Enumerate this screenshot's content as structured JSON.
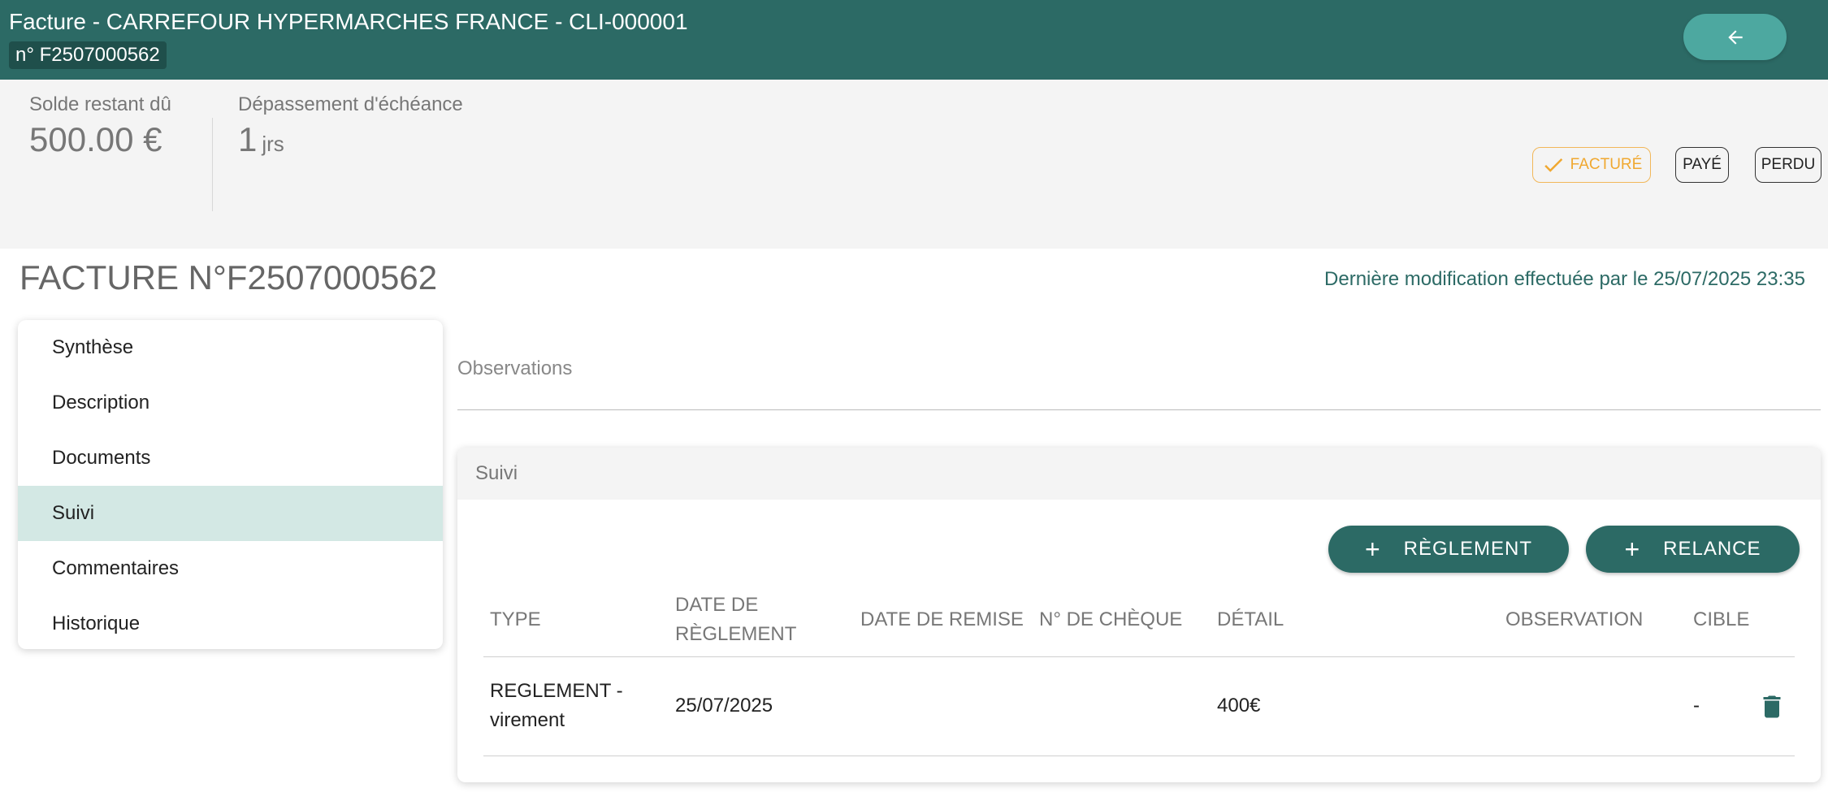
{
  "header": {
    "title": "Facture - CARREFOUR HYPERMARCHES FRANCE - CLI-000001",
    "subtitle": "n° F2507000562",
    "back_icon": "arrow-left-icon"
  },
  "summary": {
    "balance_label": "Solde restant dû",
    "balance_value": "500.00 €",
    "overdue_label": "Dépassement d'échéance",
    "overdue_value": "1",
    "overdue_unit": "jrs"
  },
  "status": {
    "facture_label": "FACTURÉ",
    "paye_label": "PAYÉ",
    "perdu_label": "PERDU",
    "active_color": "#f0a830"
  },
  "document": {
    "title": "FACTURE N°F2507000562",
    "last_modified": "Dernière modification effectuée par le 25/07/2025 23:35"
  },
  "menu": {
    "items": [
      {
        "label": "Synthèse"
      },
      {
        "label": "Description"
      },
      {
        "label": "Documents"
      },
      {
        "label": "Suivi",
        "active": true
      },
      {
        "label": "Commentaires"
      },
      {
        "label": "Historique"
      }
    ]
  },
  "observations": {
    "label": "Observations"
  },
  "suivi": {
    "title": "Suivi",
    "reglement_button": "RÈGLEMENT",
    "relance_button": "RELANCE",
    "columns": {
      "type": "TYPE",
      "date_reglement_1": "DATE DE",
      "date_reglement_2": "RÈGLEMENT",
      "date_remise": "DATE DE REMISE",
      "cheque": "N° DE CHÈQUE",
      "detail": "DÉTAIL",
      "observation": "OBSERVATION",
      "cible": "CIBLE"
    },
    "rows": [
      {
        "type_1": "REGLEMENT -",
        "type_2": "virement",
        "date_reglement": "25/07/2025",
        "date_remise": "",
        "cheque": "",
        "detail": "400€",
        "observation": "",
        "cible": "-"
      }
    ]
  },
  "colors": {
    "primary": "#2c6a65",
    "accent": "#4da8a0",
    "active_menu": "#d3e8e4"
  }
}
